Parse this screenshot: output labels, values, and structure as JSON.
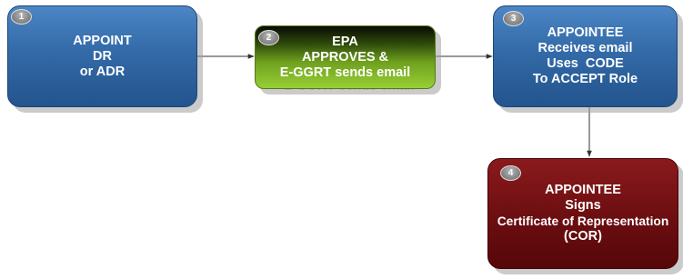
{
  "steps": [
    {
      "number": "1",
      "lines": [
        "APPOINT",
        "DR",
        "or ADR"
      ]
    },
    {
      "number": "2",
      "lines": [
        "EPA",
        "APPROVES &",
        "E-GGRT sends email"
      ]
    },
    {
      "number": "3",
      "lines": [
        "APPOINTEE",
        "Receives email",
        "Uses  CODE",
        "To ACCEPT Role"
      ]
    },
    {
      "number": "4",
      "lines": [
        "APPOINTEE",
        "Signs",
        "Certificate of Representation",
        "(COR)"
      ]
    }
  ],
  "colors": {
    "step1": "#336aa8",
    "step2": "#6fa11e",
    "step3": "#336aa8",
    "step4": "#6e0f12",
    "connector": "#333333"
  }
}
